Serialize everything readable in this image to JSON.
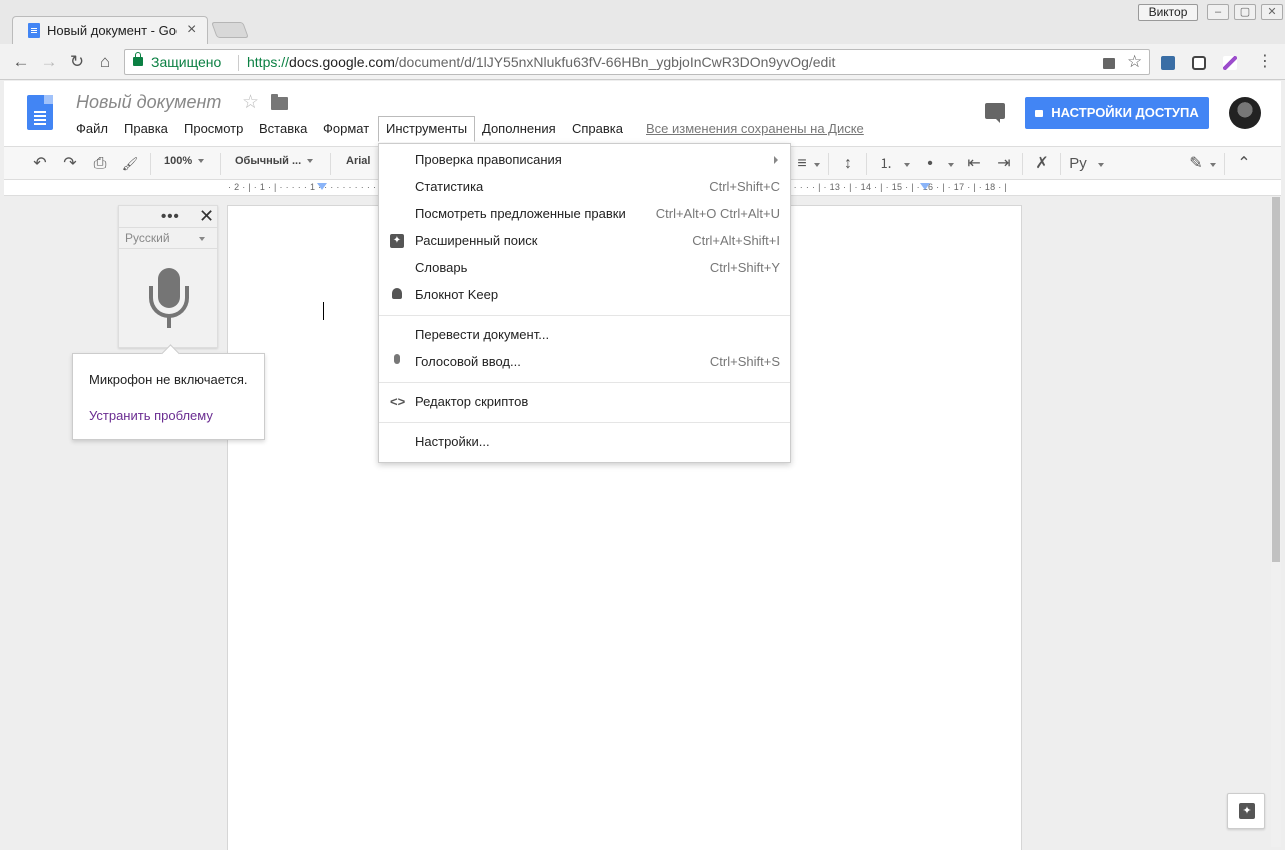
{
  "browser": {
    "tab_title": "Новый документ - Google Документы",
    "tab_close": "×",
    "user_badge": "Виктор",
    "win_min": "–",
    "win_max": "▢",
    "win_close": "✕",
    "secure_label": "Защищено",
    "url_scheme": "https://",
    "url_host": "docs.google.com",
    "url_path": "/document/d/1lJY55nxNlukfu63fV-66HBn_ygbjoInCwR3DOn9yvOg/edit",
    "back_icon": "←",
    "forward_icon": "→",
    "reload_icon": "↻",
    "home_icon": "⌂",
    "star_icon": "☆",
    "menu_icon": "⋮"
  },
  "docs": {
    "title": "Новый документ",
    "star_icon": "☆",
    "menu": [
      "Файл",
      "Правка",
      "Просмотр",
      "Вставка",
      "Формат",
      "Инструменты",
      "Дополнения",
      "Справка"
    ],
    "saved_status": "Все изменения сохранены на Диске",
    "share_button": "НАСТРОЙКИ ДОСТУПА"
  },
  "toolbar": {
    "undo": "↶",
    "redo": "↷",
    "print": "⎙",
    "paint": "🖌",
    "zoom": "100%",
    "style": "Обычный ...",
    "font": "Arial",
    "align": "≡",
    "line_spacing": "↕",
    "numbered": "⒈",
    "bulleted": "•",
    "indent_less": "⇤",
    "indent_more": "⇥",
    "clear": "✗",
    "input_tools": "Ру",
    "edit_mode": "✎",
    "collapse": "⌃"
  },
  "ruler": {
    "numbers": "· 2 · | · 1 · | · · · · · 1 · · · · · · · · · · · · · · · · · · · · · · · · · · · · · · · · · · · · · · · · · · · · · · · · · · · · · · · · · · · · · · · · · · · · · · · · · · · · · · · · · · | · 13 · | · 14 · | · 15 · | · 16 · | · 17 · | · 18 · |"
  },
  "voice_panel": {
    "dots": "•••",
    "close": "✕",
    "language": "Русский"
  },
  "mic_popup": {
    "message": "Микрофон не включается.",
    "link": "Устранить проблему"
  },
  "tools_menu": {
    "groups": [
      [
        {
          "label": "Проверка правописания",
          "shortcut": "",
          "submenu": true,
          "icon": ""
        },
        {
          "label": "Статистика",
          "shortcut": "Ctrl+Shift+C",
          "icon": ""
        },
        {
          "label": "Посмотреть предложенные правки",
          "shortcut": "Ctrl+Alt+O Ctrl+Alt+U",
          "icon": ""
        },
        {
          "label": "Расширенный поиск",
          "shortcut": "Ctrl+Alt+Shift+I",
          "icon": "explore-icon"
        },
        {
          "label": "Словарь",
          "shortcut": "Ctrl+Shift+Y",
          "icon": ""
        },
        {
          "label": "Блокнот Keep",
          "shortcut": "",
          "icon": "lightbulb-icon"
        }
      ],
      [
        {
          "label": "Перевести документ...",
          "shortcut": "",
          "icon": ""
        },
        {
          "label": "Голосовой ввод...",
          "shortcut": "Ctrl+Shift+S",
          "icon": "microphone-icon"
        }
      ],
      [
        {
          "label": "Редактор скриптов",
          "shortcut": "",
          "icon": "code-icon"
        }
      ],
      [
        {
          "label": "Настройки...",
          "shortcut": "",
          "icon": ""
        }
      ]
    ]
  },
  "colors": {
    "accent": "#4285f4",
    "secure_green": "#0b8043",
    "link_purple": "#6a2c91"
  }
}
